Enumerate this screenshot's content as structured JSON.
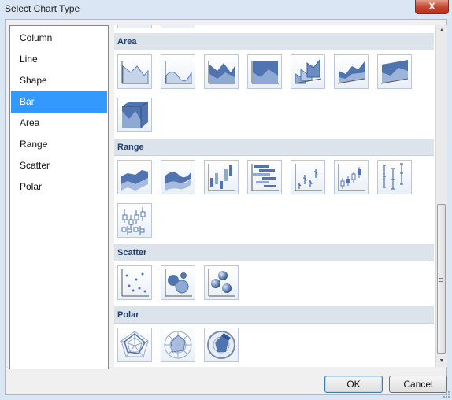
{
  "window": {
    "title": "Select Chart Type",
    "close_glyph": "X"
  },
  "categories": [
    {
      "label": "Column",
      "selected": false
    },
    {
      "label": "Line",
      "selected": false
    },
    {
      "label": "Shape",
      "selected": false
    },
    {
      "label": "Bar",
      "selected": true
    },
    {
      "label": "Area",
      "selected": false
    },
    {
      "label": "Range",
      "selected": false
    },
    {
      "label": "Scatter",
      "selected": false
    },
    {
      "label": "Polar",
      "selected": false
    }
  ],
  "sections": {
    "area": {
      "header": "Area",
      "thumbs": [
        "area-chart-icon",
        "smooth-area-chart-icon",
        "stacked-area-chart-icon",
        "stacked-area-100-chart-icon",
        "area-3d-chart-icon",
        "stacked-area-3d-chart-icon",
        "stacked-area-100-3d-chart-icon",
        "full-area-3d-chart-icon"
      ]
    },
    "range": {
      "header": "Range",
      "thumbs": [
        "range-area-chart-icon",
        "smooth-range-area-chart-icon",
        "range-column-chart-icon",
        "range-bar-chart-icon",
        "stock-chart-icon",
        "candlestick-chart-icon",
        "error-bar-chart-icon",
        "box-plot-chart-icon"
      ]
    },
    "scatter": {
      "header": "Scatter",
      "thumbs": [
        "point-chart-icon",
        "bubble-chart-icon",
        "bubble-3d-chart-icon"
      ]
    },
    "polar": {
      "header": "Polar",
      "thumbs": [
        "radar-chart-icon",
        "polar-chart-icon",
        "polar-3d-chart-icon"
      ]
    }
  },
  "buttons": {
    "ok": "OK",
    "cancel": "Cancel"
  },
  "colors": {
    "selection": "#3399ff",
    "header_text": "#1d3f6e",
    "icon_fill": "#4f74b0"
  }
}
